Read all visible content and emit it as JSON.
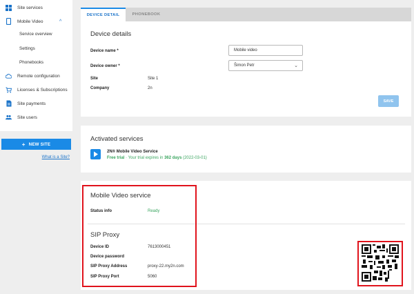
{
  "sidebar": {
    "site_services": "Site services",
    "mobile_video": "Mobile Video",
    "service_overview": "Service overview",
    "settings": "Settings",
    "phonebooks": "Phonebooks",
    "remote_configuration": "Remote configuration",
    "licenses": "Licenses & Subscriptions",
    "site_payments": "Site payments",
    "site_users": "Site users",
    "new_site": "NEW SITE",
    "what_is_site": "What is a Site?"
  },
  "tabs": {
    "device_detail": "DEVICE DETAIL",
    "phonebook": "PHONEBOOK"
  },
  "device_details": {
    "title": "Device details",
    "name_label": "Device name *",
    "name_value": "Mobile video",
    "owner_label": "Device owner *",
    "owner_value": "Šimon Petr",
    "site_label": "Site",
    "site_value": "Site 1",
    "company_label": "Company",
    "company_value": "2n",
    "save": "SAVE"
  },
  "activated_services": {
    "title": "Activated services",
    "service_name": "2N® Mobile Video Service",
    "trial_prefix": "Free trial",
    "trial_middle": " · Your trial expires in ",
    "trial_days": "362 days",
    "trial_date": " (2022-03-01)"
  },
  "mobile_video_service": {
    "title": "Mobile Video service",
    "status_label": "Status info",
    "status_value": "Ready",
    "sip_title": "SIP Proxy",
    "device_id_label": "Device ID",
    "device_id_value": "7613000451",
    "password_label": "Device password",
    "address_label": "SIP Proxy Address",
    "address_value": "proxy-22.my2n.com",
    "port_label": "SIP Proxy Port",
    "port_value": "5060"
  },
  "colors": {
    "accent": "#1a8ae6",
    "highlight": "#e0121b",
    "success": "#3aa55f"
  }
}
